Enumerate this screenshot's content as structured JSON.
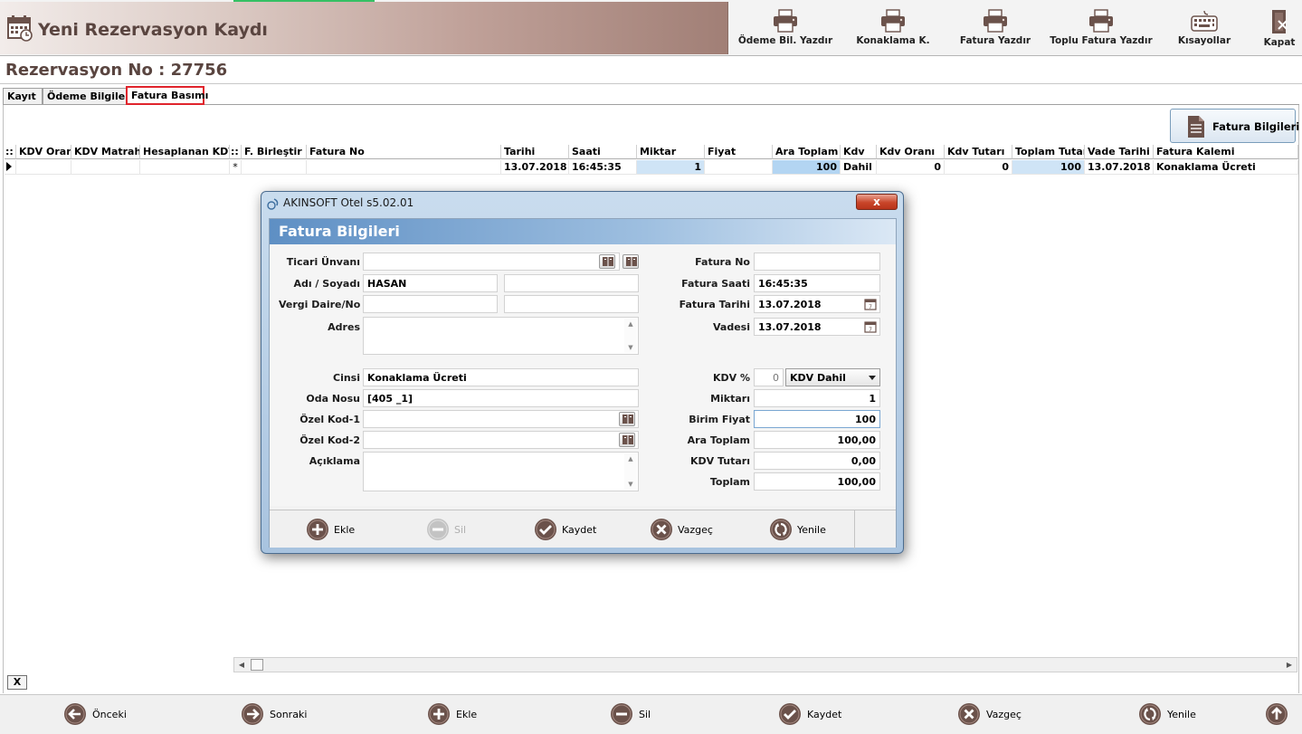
{
  "window": {
    "title": "Yeni Rezervasyon Kaydı"
  },
  "toolbar": {
    "items": [
      {
        "label": "Ödeme Bil. Yazdır",
        "icon": "printer-icon"
      },
      {
        "label": "Konaklama K.",
        "icon": "printer-icon"
      },
      {
        "label": "Fatura Yazdır",
        "icon": "printer-icon"
      },
      {
        "label": "Toplu Fatura Yazdır",
        "icon": "printer-icon"
      },
      {
        "label": "Kısayollar",
        "icon": "keyboard-icon"
      },
      {
        "label": "Kapat",
        "icon": "exit-icon"
      }
    ]
  },
  "reservation": {
    "label": "Rezervasyon No : 27756"
  },
  "tabs": [
    {
      "label": "Kayıt",
      "active": false
    },
    {
      "label": "Ödeme Bilgileri",
      "active": false
    },
    {
      "label": "Fatura Basımı",
      "active": true
    }
  ],
  "fatura_bilgileri_button": {
    "label": "Fatura Bilgileri",
    "icon": "document-icon"
  },
  "grid": {
    "group_markers": [
      "::",
      "::"
    ],
    "columns": [
      "KDV Oranı",
      "KDV Matrahı",
      "Hesaplanan KDV",
      "F. Birleştir",
      "Fatura No",
      "Tarihi",
      "Saati",
      "Miktar",
      "Fiyat",
      "Ara Toplam",
      "Kdv",
      "Kdv Oranı",
      "Kdv Tutarı",
      "Toplam Tutar",
      "Vade Tarihi",
      "Fatura Kalemi"
    ],
    "rows": [
      {
        "kdv_orani": "",
        "kdv_matrahi": "",
        "hesaplanan_kdv": "",
        "marker": "*",
        "f_birlestir": "",
        "fatura_no": "",
        "tarihi": "13.07.2018",
        "saati": "16:45:35",
        "miktar": "1",
        "fiyat": "",
        "ara_toplam": "100",
        "kdv": "Dahil",
        "kdv_orani2": "0",
        "kdv_tutari": "0",
        "toplam_tutar": "100",
        "vade_tarihi": "13.07.2018",
        "fatura_kalemi": "Konaklama Ücreti"
      }
    ]
  },
  "grid_close_label": "X",
  "bottom_bar": {
    "items": [
      {
        "label": "Önceki",
        "icon": "arrow-left-icon"
      },
      {
        "label": "Sonraki",
        "icon": "arrow-right-icon"
      },
      {
        "label": "Ekle",
        "icon": "plus-icon"
      },
      {
        "label": "Sil",
        "icon": "minus-icon"
      },
      {
        "label": "Kaydet",
        "icon": "check-icon"
      },
      {
        "label": "Vazgeç",
        "icon": "cancel-icon"
      },
      {
        "label": "Yenile",
        "icon": "refresh-icon"
      },
      {
        "label": "",
        "icon": "arrow-up-icon"
      }
    ]
  },
  "dialog": {
    "window_title": "AKINSOFT Otel s5.02.01",
    "close_label": "x",
    "header": "Fatura Bilgileri",
    "left": {
      "ticari_unvani": {
        "label": "Ticari Ünvanı",
        "value": ""
      },
      "adi_soyadi": {
        "label": "Adı / Soyadı",
        "value": "HASAN",
        "value2": ""
      },
      "vergi": {
        "label": "Vergi Daire/No",
        "value": "",
        "value2": ""
      },
      "adres": {
        "label": "Adres",
        "value": ""
      },
      "cinsi": {
        "label": "Cinsi",
        "value": "Konaklama Ücreti"
      },
      "oda_nosu": {
        "label": "Oda Nosu",
        "value": "[405  _1]"
      },
      "ozel_kod_1": {
        "label": "Özel Kod-1",
        "value": ""
      },
      "ozel_kod_2": {
        "label": "Özel Kod-2",
        "value": ""
      },
      "aciklama": {
        "label": "Açıklama",
        "value": ""
      }
    },
    "right": {
      "fatura_no": {
        "label": "Fatura No",
        "value": ""
      },
      "fatura_saati": {
        "label": "Fatura Saati",
        "value": "16:45:35"
      },
      "fatura_tarihi": {
        "label": "Fatura Tarihi",
        "value": "13.07.2018"
      },
      "vadesi": {
        "label": "Vadesi",
        "value": "13.07.2018"
      },
      "kdv": {
        "label": "KDV %",
        "value": "0",
        "select": "KDV Dahil"
      },
      "miktari": {
        "label": "Miktarı",
        "value": "1"
      },
      "birim_fiyat": {
        "label": "Birim Fiyat",
        "value": "100"
      },
      "ara_toplam": {
        "label": "Ara Toplam",
        "value": "100,00"
      },
      "kdv_tutari": {
        "label": "KDV Tutarı",
        "value": "0,00"
      },
      "toplam": {
        "label": "Toplam",
        "value": "100,00"
      }
    },
    "footer": [
      {
        "label": "Ekle",
        "icon": "plus-icon",
        "enabled": true
      },
      {
        "label": "Sil",
        "icon": "minus-icon",
        "enabled": false
      },
      {
        "label": "Kaydet",
        "icon": "check-icon",
        "enabled": true
      },
      {
        "label": "Vazgeç",
        "icon": "cancel-icon",
        "enabled": true
      },
      {
        "label": "Yenile",
        "icon": "refresh-icon",
        "enabled": true
      }
    ]
  },
  "colors": {
    "accent_brown": "#6b524b",
    "title_text": "#5a4540",
    "tab_highlight": "#e0242c",
    "grid_highlight": "#cfe4f6",
    "dialog_header": "#5e8fc4"
  }
}
